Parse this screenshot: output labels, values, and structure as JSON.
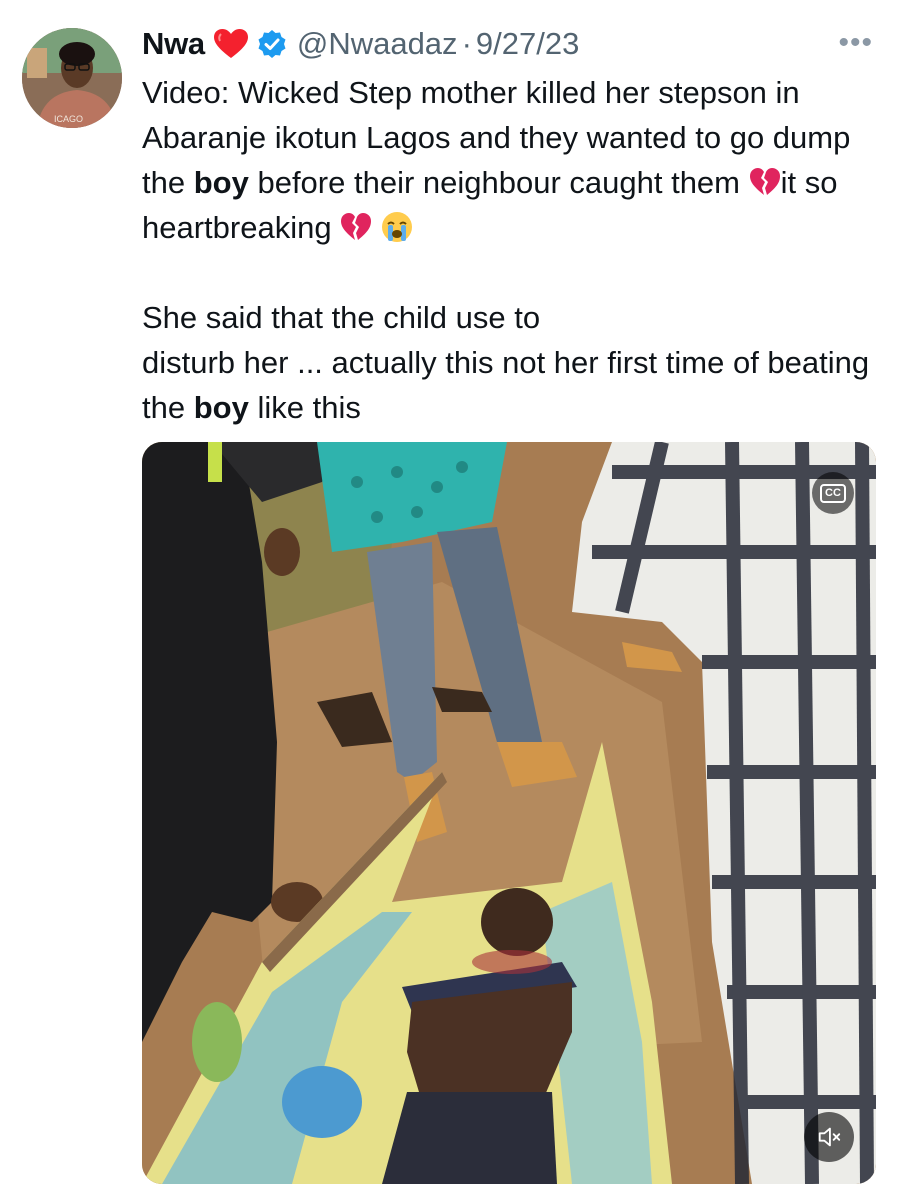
{
  "tweet": {
    "author_name": "Nwa",
    "handle": "@Nwaadaz",
    "separator": "·",
    "date": "9/27/23",
    "more_label": "•••",
    "avatar_shirt_text": "ICAGO",
    "paragraph1": {
      "part1": "Video: Wicked Step mother killed her stepson in Abaranje ikotun Lagos and they wanted to go dump the ",
      "bold1": "boy",
      "part2": " before their neighbour caught them ",
      "part3": "it so heartbreaking "
    },
    "paragraph2": {
      "part1": "She said that the child use to",
      "part2": "disturb her ... actually this not her first time of beating the ",
      "bold1": "boy",
      "part3": " like this"
    }
  },
  "media": {
    "cc_label": "CC",
    "icons": [
      "cc-icon",
      "mute-icon",
      "broken-heart-icon",
      "crying-face-icon",
      "red-heart-icon",
      "verified-badge-icon"
    ]
  },
  "colors": {
    "text": "#0f1419",
    "secondary": "#536471",
    "verified": "#1d9bf0",
    "heart": "#f4212e"
  }
}
